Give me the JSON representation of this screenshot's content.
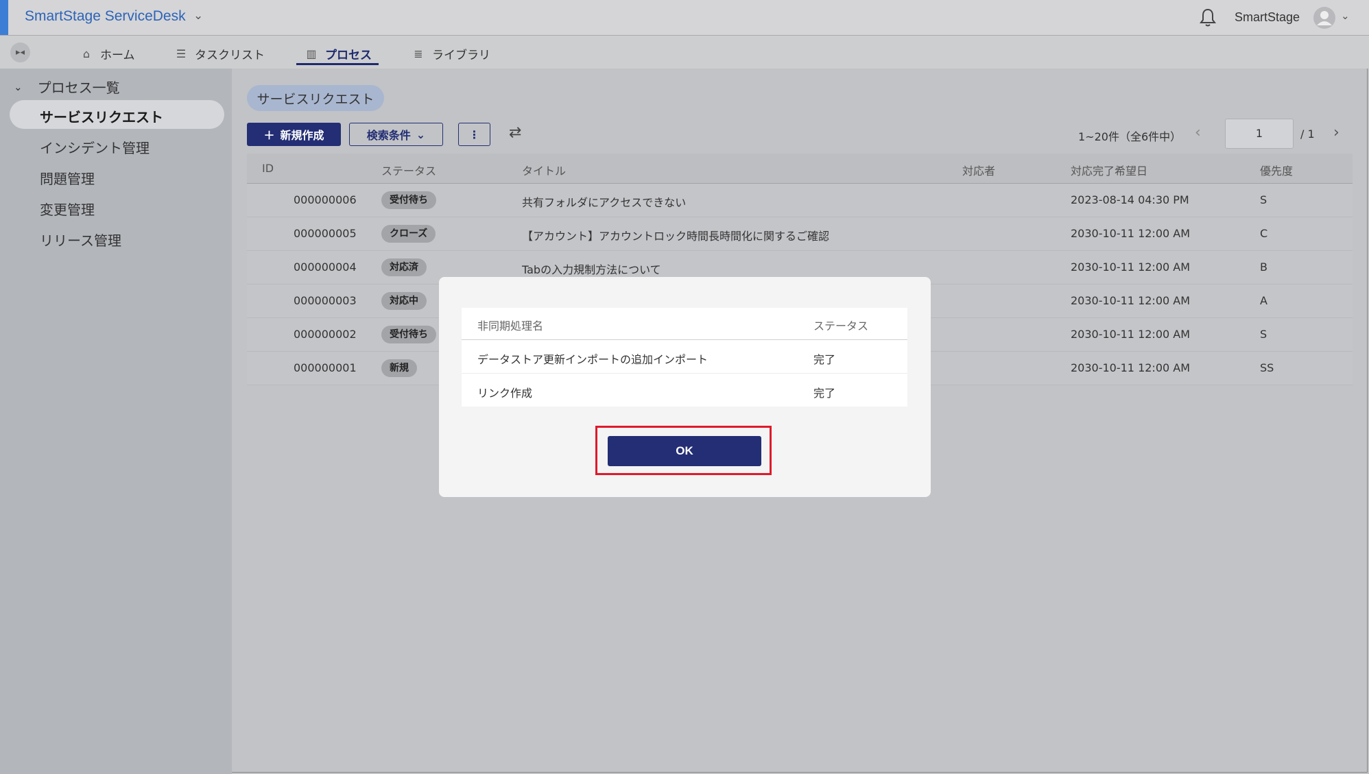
{
  "app": {
    "title": "SmartStage ServiceDesk",
    "user": "SmartStage"
  },
  "nav": {
    "tabs": [
      {
        "label": "ホーム",
        "icon": "home-icon"
      },
      {
        "label": "タスクリスト",
        "icon": "checklist-icon"
      },
      {
        "label": "プロセス",
        "icon": "building-icon",
        "active": true
      },
      {
        "label": "ライブラリ",
        "icon": "list-icon"
      }
    ]
  },
  "sidebar": {
    "heading": "プロセス一覧",
    "items": [
      {
        "label": "サービスリクエスト",
        "active": true
      },
      {
        "label": "インシデント管理"
      },
      {
        "label": "問題管理"
      },
      {
        "label": "変更管理"
      },
      {
        "label": "リリース管理"
      }
    ]
  },
  "content": {
    "chip": "サービスリクエスト",
    "new_button": "新規作成",
    "search_button": "検索条件",
    "pagination": {
      "range": "1~20件（全6件中）",
      "page": "1",
      "total": "/ 1"
    }
  },
  "table": {
    "headers": [
      "ID",
      "ステータス",
      "タイトル",
      "対応者",
      "対応完了希望日",
      "優先度"
    ],
    "rows": [
      {
        "id": "000000006",
        "status": "受付待ち",
        "title": "共有フォルダにアクセスできない",
        "assignee": "",
        "due": "2023-08-14 04:30 PM",
        "priority": "S"
      },
      {
        "id": "000000005",
        "status": "クローズ",
        "title": "【アカウント】アカウントロック時間長時間化に関するご確認",
        "assignee": "",
        "due": "2030-10-11 12:00 AM",
        "priority": "C"
      },
      {
        "id": "000000004",
        "status": "対応済",
        "title": "Tabの入力規制方法について",
        "assignee": "",
        "due": "2030-10-11 12:00 AM",
        "priority": "B"
      },
      {
        "id": "000000003",
        "status": "対応中",
        "title": "",
        "assignee": "",
        "due": "2030-10-11 12:00 AM",
        "priority": "A"
      },
      {
        "id": "000000002",
        "status": "受付待ち",
        "title": "",
        "assignee": "",
        "due": "2030-10-11 12:00 AM",
        "priority": "S"
      },
      {
        "id": "000000001",
        "status": "新規",
        "title": "",
        "assignee": "",
        "due": "2030-10-11 12:00 AM",
        "priority": "SS"
      }
    ]
  },
  "modal": {
    "headers": [
      "非同期処理名",
      "ステータス"
    ],
    "rows": [
      {
        "name": "データストア更新インポートの追加インポート",
        "status": "完了"
      },
      {
        "name": "リンク作成",
        "status": "完了"
      }
    ],
    "ok_label": "OK"
  },
  "colors": {
    "primary": "#232e74",
    "accent": "#3c7ed6",
    "highlight": "#e0192b"
  }
}
